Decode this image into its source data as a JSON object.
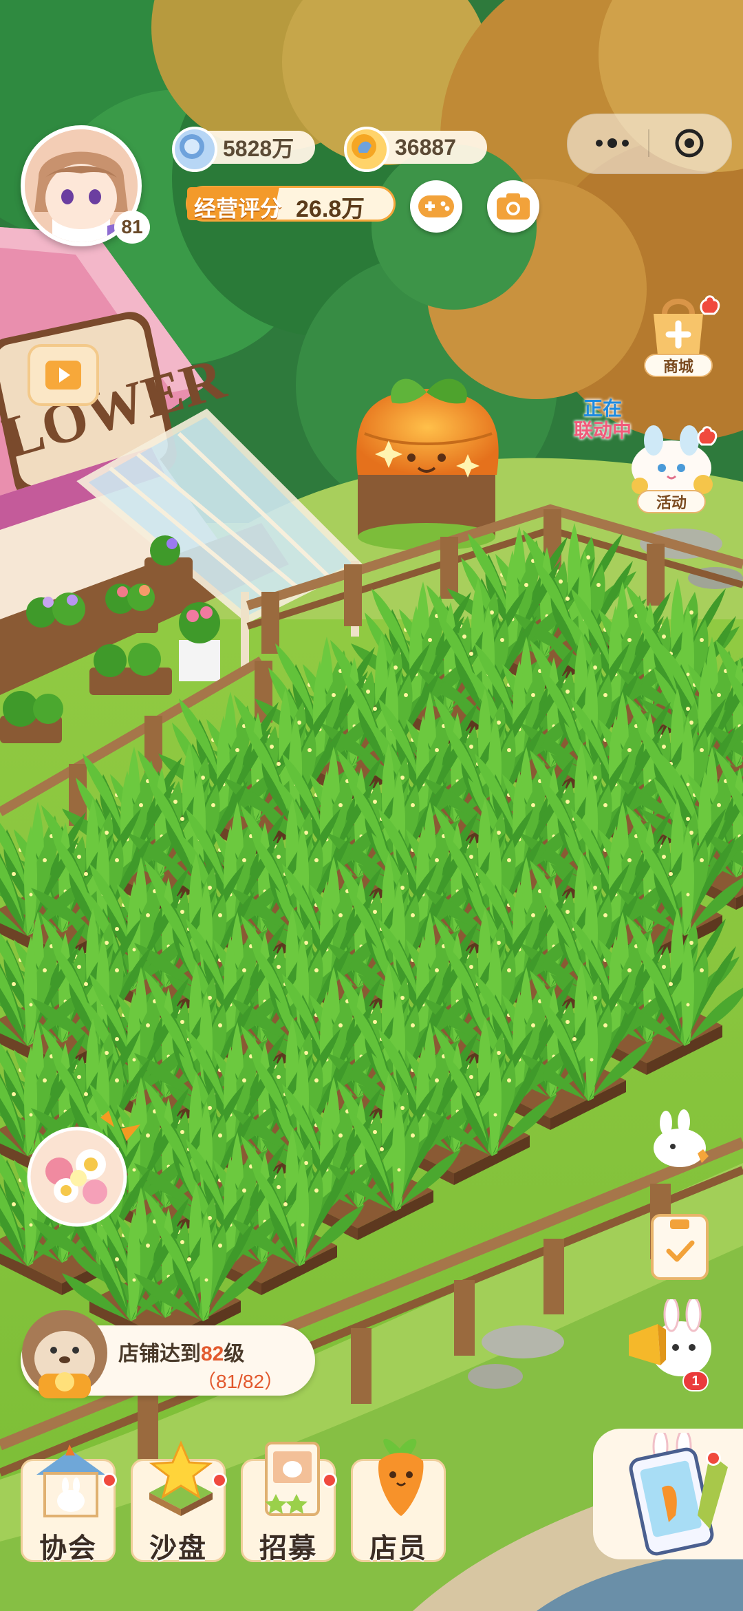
{
  "hud": {
    "player_level": "81",
    "currency_1": "5828万",
    "currency_2": "36887",
    "score_label": "经营评分",
    "score_value": "26.8万"
  },
  "shop_sign": "LOWER",
  "side_buttons": {
    "shop_label": "商城",
    "collab_line1": "正在",
    "collab_line2": "联动中",
    "activity_label": "活动",
    "announcer_badge": "1"
  },
  "quest": {
    "prefix": "店铺达到",
    "level": "82",
    "suffix": "级",
    "progress": "（81/82）"
  },
  "bottom_nav": [
    {
      "label": "协会"
    },
    {
      "label": "沙盘"
    },
    {
      "label": "招募"
    },
    {
      "label": "店员"
    }
  ],
  "colors": {
    "grass": "#8cc63f",
    "soil": "#8a5a34",
    "accent_orange": "#f4a53a",
    "alert_red": "#f04a3e"
  }
}
